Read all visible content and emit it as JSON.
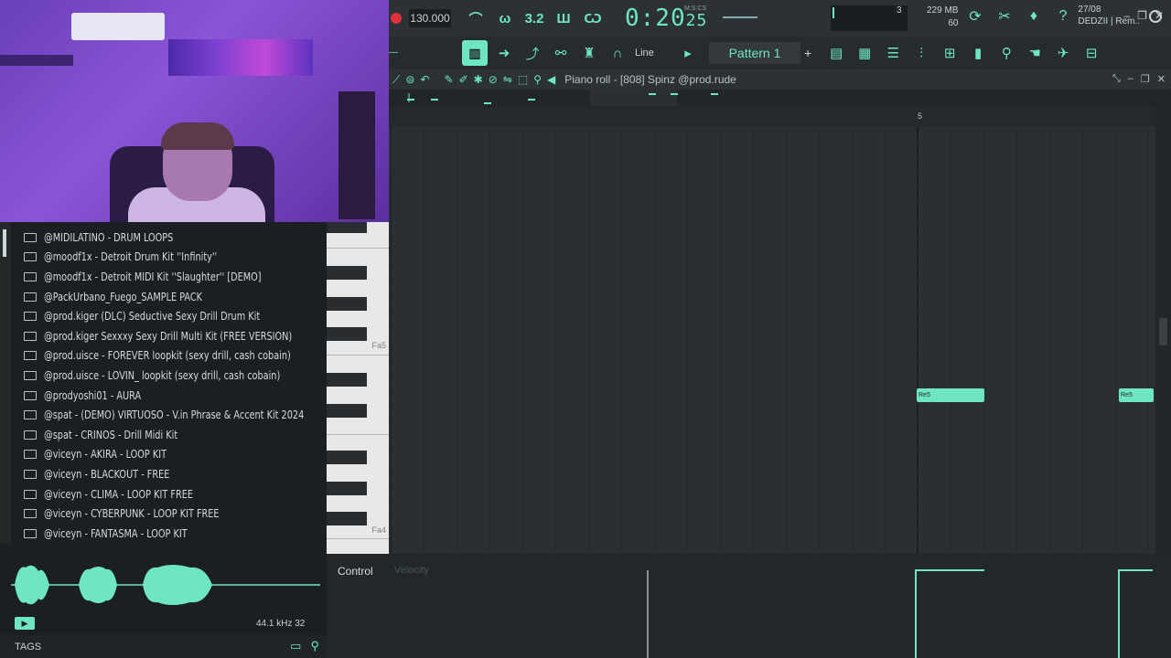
{
  "toolbar": {
    "tempo": "130.000",
    "time_main": "0:20",
    "time_sub": "25",
    "time_format": "M:S:CS",
    "cpu_value": "3",
    "memory": "229 MB",
    "polyphony": "60",
    "line_mode": "Line",
    "pattern": "Pattern 1",
    "date": "27/08",
    "user": "DEDZII | Rem.."
  },
  "browser": {
    "items": [
      "@MIDILATINO - DRUM LOOPS",
      "@moodf1x - Detroit Drum Kit ''Infinity''",
      "@moodf1x - Detroit MIDI Kit ''Slaughter'' [DEMO]",
      "@PackUrbano_Fuego_SAMPLE PACK",
      "@prod.kiger (DLC) Seductive Sexy Drill Drum Kit",
      "@prod.kiger Sexxxy Sexy Drill Multi Kit (FREE VERSION)",
      "@prod.uisce - FOREVER loopkit (sexy drill, cash cobain)",
      "@prod.uisce - LOVIN_ loopkit (sexy drill, cash cobain)",
      "@prodyoshi01 - AURA",
      "@spat - (DEMO) VIRTUOSO - V.in Phrase & Accent Kit 2024",
      "@spat - CRINOS - Drill Midi Kit",
      "@viceyn - AKIRA - LOOP KIT",
      "@viceyn - BLACKOUT - FREE",
      "@viceyn - CLIMA - LOOP KIT FREE",
      "@viceyn - CYBERPUNK - LOOP KIT FREE",
      "@viceyn - FANTASMA - LOOP KIT"
    ],
    "sample_info": "44.1 kHz 32",
    "tags_label": "TAGS"
  },
  "piano": {
    "label_fa5": "Fa5",
    "label_fa4": "Fa4"
  },
  "piano_roll": {
    "title": "Piano roll - [808] Spinz @prod.rude",
    "ruler_bar": "5",
    "notes": [
      {
        "label": "Re5"
      },
      {
        "label": "Re5"
      }
    ]
  },
  "control": {
    "label": "Control",
    "velocity": "Velocity"
  },
  "colors": {
    "accent": "#6ee6c2",
    "background": "#1e2224",
    "record": "#e0303a"
  }
}
